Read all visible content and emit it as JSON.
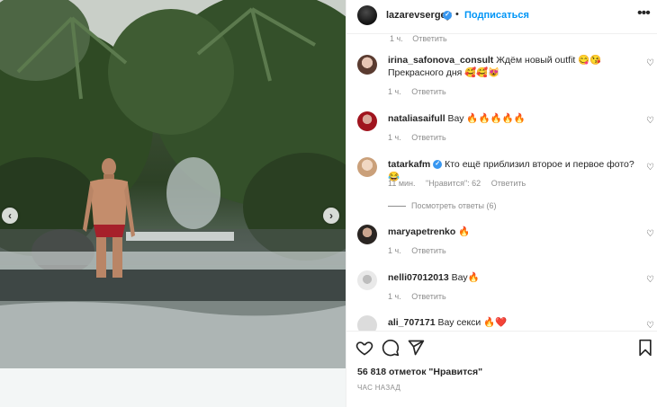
{
  "header": {
    "username": "lazarevsergey",
    "follow_label": "Подписаться",
    "separator": "•",
    "more_label": "•••"
  },
  "comments_area": {
    "cutoff_time": "1 ч.",
    "cutoff_reply": "Ответить",
    "items": [
      {
        "username": "irina_safonova_consult",
        "text": "Ждём новый outfit 😋😘 Прекрасного дня 🥰🥰😻",
        "time": "1 ч.",
        "reply": "Ответить"
      },
      {
        "username": "nataliasaifull",
        "text": "Вау 🔥🔥🔥🔥🔥",
        "time": "1 ч.",
        "reply": "Ответить"
      },
      {
        "username": "tatarkafm",
        "verified": true,
        "text": "Кто ещё приблизил второе и первое фото?😂",
        "time": "11 мин.",
        "likes": "\"Нравится\": 62",
        "reply": "Ответить",
        "view_replies": "Посмотреть ответы (6)"
      },
      {
        "username": "maryapetrenko",
        "text": "🔥",
        "time": "1 ч.",
        "reply": "Ответить"
      },
      {
        "username": "nelli07012013",
        "text": "Вау🔥",
        "time": "1 ч.",
        "reply": "Ответить"
      },
      {
        "username": "ali_707171",
        "text": "Вау секси 🔥❤️",
        "time": "",
        "reply": ""
      }
    ]
  },
  "actions": {
    "likes_text": "56 818 отметок \"Нравится\"",
    "time_ago": "ЧАС НАЗАД"
  },
  "colors": {
    "accent": "#0095f6",
    "verified": "#3897f0",
    "muted": "#8e8e8e",
    "text": "#262626"
  },
  "icons": [
    "chevron-left-icon",
    "chevron-right-icon",
    "heart-icon",
    "comment-icon",
    "share-icon",
    "bookmark-icon",
    "more-icon",
    "verified-icon"
  ]
}
